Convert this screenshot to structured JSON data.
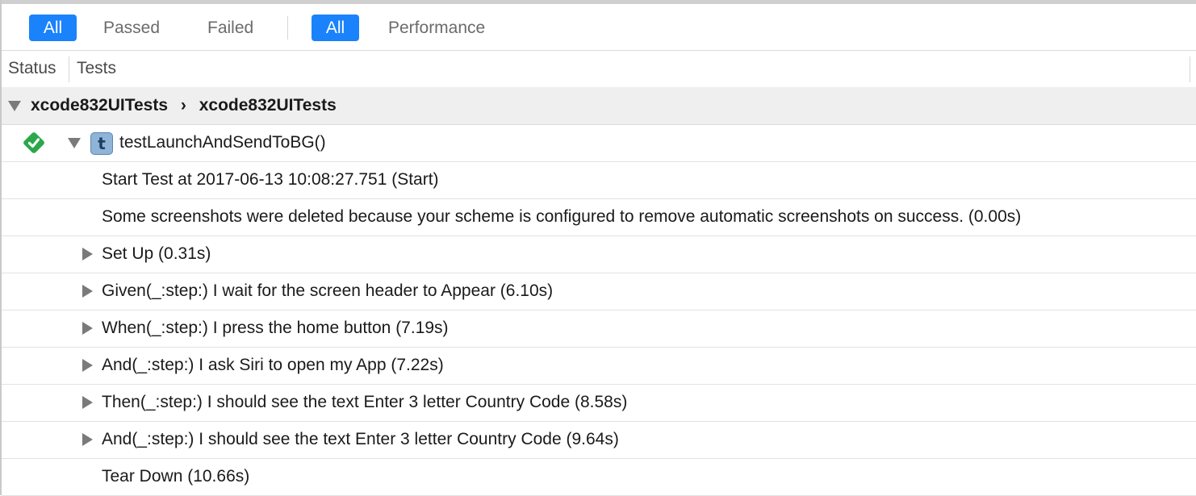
{
  "filters": {
    "group1": [
      {
        "label": "All",
        "active": true
      },
      {
        "label": "Passed",
        "active": false
      },
      {
        "label": "Failed",
        "active": false
      }
    ],
    "group2": [
      {
        "label": "All",
        "active": true
      },
      {
        "label": "Performance",
        "active": false
      }
    ]
  },
  "columns": {
    "status": "Status",
    "tests": "Tests"
  },
  "suite": {
    "part1": "xcode832UITests",
    "separator": "›",
    "part2": "xcode832UITests"
  },
  "test": {
    "name": "testLaunchAndSendToBG()",
    "status": "passed",
    "icon_letter": "t"
  },
  "activities": [
    {
      "label": "Start Test at 2017-06-13 10:08:27.751 (Start)",
      "expandable": false
    },
    {
      "label": "Some screenshots were deleted because your scheme is configured to remove automatic screenshots on success. (0.00s)",
      "expandable": false
    },
    {
      "label": "Set Up (0.31s)",
      "expandable": true
    },
    {
      "label": "Given(_:step:) I wait for the screen header to Appear (6.10s)",
      "expandable": true
    },
    {
      "label": "When(_:step:) I press the home button (7.19s)",
      "expandable": true
    },
    {
      "label": "And(_:step:) I ask Siri to open my App (7.22s)",
      "expandable": true
    },
    {
      "label": "Then(_:step:) I should see the text Enter 3 letter Country Code (8.58s)",
      "expandable": true
    },
    {
      "label": "And(_:step:) I should see the text Enter 3 letter Country Code (9.64s)",
      "expandable": true
    },
    {
      "label": "Tear Down (10.66s)",
      "expandable": false
    }
  ],
  "colors": {
    "accent": "#1a82fb",
    "pass": "#2aa84a"
  }
}
